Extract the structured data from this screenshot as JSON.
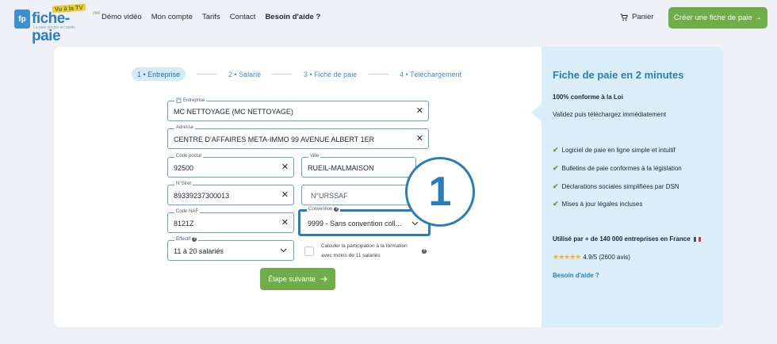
{
  "brand": {
    "badge": "fp",
    "name": "fiche-paie",
    "tv_badge": "Vu à la TV",
    "suffix": ".net",
    "tagline": "La paie simple et rapide"
  },
  "nav": {
    "items": [
      {
        "label": "Démo vidéo",
        "bold": false
      },
      {
        "label": "Mon compte",
        "bold": false
      },
      {
        "label": "Tarifs",
        "bold": false
      },
      {
        "label": "Contact",
        "bold": false
      },
      {
        "label": "Besoin d'aide ?",
        "bold": true
      }
    ],
    "cart_label": "Panier",
    "cta_label": "Créer une fiche de paie →"
  },
  "steps": [
    {
      "label": "1 • Entreprise",
      "active": true
    },
    {
      "label": "2 • Salarié",
      "active": false
    },
    {
      "label": "3 • Fiche de paie",
      "active": false
    },
    {
      "label": "4 • Téléchargement",
      "active": false
    }
  ],
  "form": {
    "entreprise": {
      "label": "Entreprise",
      "value": "MC NETTOYAGE (MC NETTOYAGE)"
    },
    "adresse": {
      "label": "Adresse",
      "value": "CENTRE D'AFFAIRES META-IMMO 99 AVENUE ALBERT 1ER"
    },
    "code_postal": {
      "label": "Code postal",
      "value": "92500"
    },
    "ville": {
      "label": "Ville",
      "value": "RUEIL-MALMAISON"
    },
    "siret": {
      "label": "N°Siret",
      "value": "89339237300013"
    },
    "urssaf": {
      "placeholder": "N°URSSAF"
    },
    "code_naf": {
      "label": "Code NAF",
      "value": "8121Z"
    },
    "convention": {
      "label": "Convention",
      "value": "9999 - Sans convention coll..."
    },
    "effectif": {
      "label": "Effectif",
      "value": "11 à 20 salariés"
    },
    "checkbox_label": "Calculer la participation à la formation avec moins de 11 salariés",
    "next_label": "Étape suivante"
  },
  "annotation": {
    "number": "1"
  },
  "side": {
    "title": "Fiche de paie en 2 minutes",
    "bold": "100% conforme à la Loi",
    "text": "Validez puis téléchargez immédiatement",
    "features": [
      "Logiciel de paie en ligne simple et intuitif",
      "Bulletins de paie conformes à la législation",
      "Déclarations sociales simplifiées par DSN",
      "Mises à jour légales incluses"
    ],
    "used_by": "Utilisé par + de 140 000 entreprises en France",
    "stars": "★★★★★",
    "rating": "4.9/5 (2600 avis)",
    "help": "Besoin d'aide ?"
  },
  "colors": {
    "accent": "#2a7db8",
    "cta": "#6fad49",
    "side_bg": "#daeef9"
  }
}
